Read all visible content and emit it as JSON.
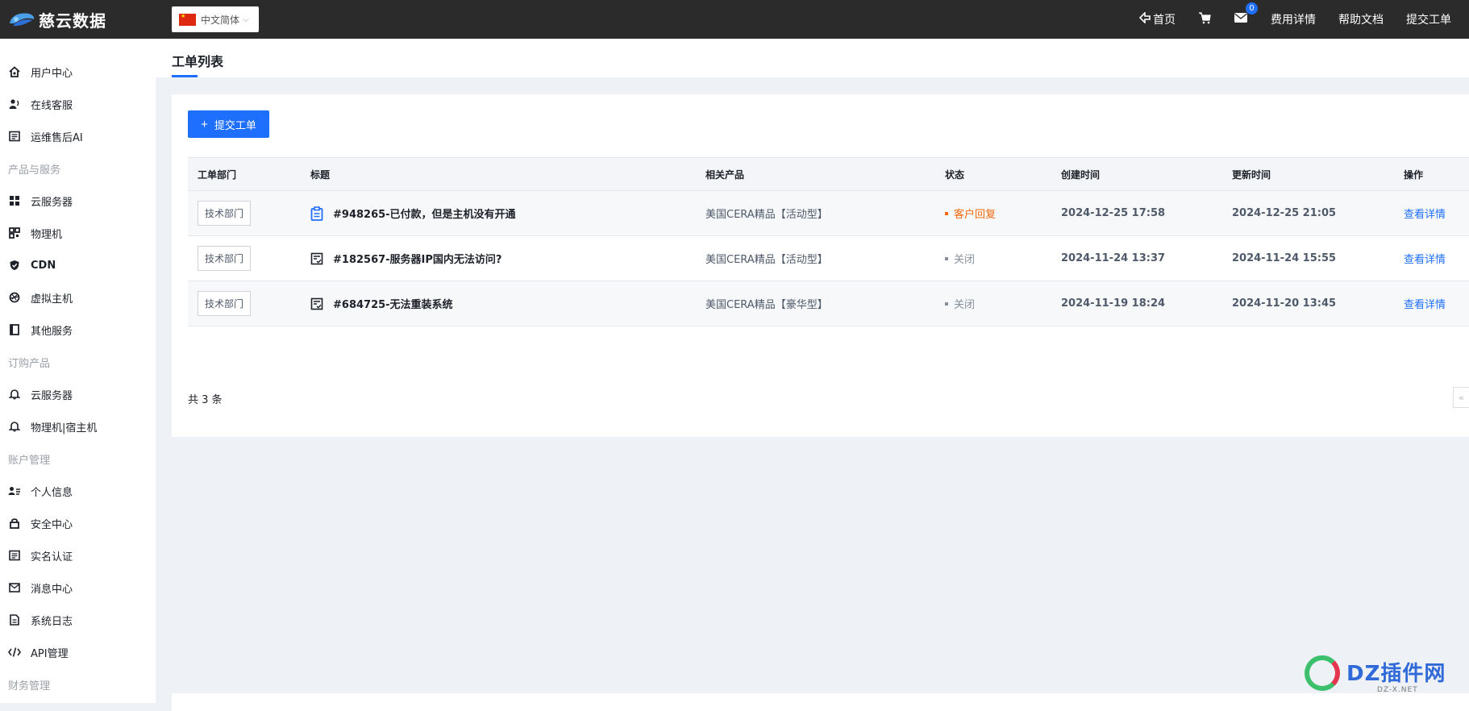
{
  "header": {
    "brand": "慈云数据",
    "language": "中文简体",
    "nav": {
      "home": "首页",
      "message_count": "0",
      "billing": "费用详情",
      "help": "帮助文档",
      "submit_ticket": "提交工单"
    }
  },
  "sidebar": {
    "top_items": [
      {
        "label": "用户中心",
        "icon": "home-icon"
      },
      {
        "label": "在线客服",
        "icon": "support-icon"
      },
      {
        "label": "运维售后AI",
        "icon": "document-icon"
      }
    ],
    "groups": [
      {
        "label": "产品与服务",
        "items": [
          {
            "label": "云服务器",
            "icon": "grid-icon"
          },
          {
            "label": "物理机",
            "icon": "qrcode-icon"
          },
          {
            "label": "CDN",
            "icon": "shield-icon"
          },
          {
            "label": "虚拟主机",
            "icon": "aperture-icon"
          },
          {
            "label": "其他服务",
            "icon": "book-icon"
          }
        ]
      },
      {
        "label": "订购产品",
        "items": [
          {
            "label": "云服务器",
            "icon": "bell-icon"
          },
          {
            "label": "物理机|宿主机",
            "icon": "bell-icon"
          }
        ]
      },
      {
        "label": "账户管理",
        "items": [
          {
            "label": "个人信息",
            "icon": "user-card-icon"
          },
          {
            "label": "安全中心",
            "icon": "lock-icon"
          },
          {
            "label": "实名认证",
            "icon": "id-card-icon"
          },
          {
            "label": "消息中心",
            "icon": "mail-icon"
          },
          {
            "label": "系统日志",
            "icon": "file-icon"
          },
          {
            "label": "API管理",
            "icon": "code-icon"
          }
        ]
      },
      {
        "label": "财务管理",
        "items": []
      }
    ]
  },
  "page": {
    "title": "工单列表",
    "submit_button": "提交工单",
    "total": "共 3 条",
    "pager_prev": "«"
  },
  "table": {
    "columns": [
      "工单部门",
      "标题",
      "相关产品",
      "状态",
      "创建时间",
      "更新时间",
      "操作"
    ],
    "rows": [
      {
        "dept": "技术部门",
        "title": "#948265-已付款，但是主机没有开通",
        "icon": "clipboard-icon",
        "product": "美国CERA精品【活动型】",
        "status": "客户回复",
        "status_type": "reply",
        "created": "2024-12-25 17:58",
        "updated": "2024-12-25 21:05",
        "action": "查看详情"
      },
      {
        "dept": "技术部门",
        "title": "#182567-服务器IP国内无法访问?",
        "icon": "checklist-icon",
        "product": "美国CERA精品【活动型】",
        "status": "关闭",
        "status_type": "closed",
        "created": "2024-11-24 13:37",
        "updated": "2024-11-24 15:55",
        "action": "查看详情"
      },
      {
        "dept": "技术部门",
        "title": "#684725-无法重装系统",
        "icon": "checklist-icon",
        "product": "美国CERA精品【豪华型】",
        "status": "关闭",
        "status_type": "closed",
        "created": "2024-11-19 18:24",
        "updated": "2024-11-20 13:45",
        "action": "查看详情"
      }
    ]
  },
  "watermark": {
    "title": "DZ插件网",
    "url": "DZ-X.NET"
  },
  "colors": {
    "accent": "#1f6fff",
    "topbar": "#2b2b2b",
    "status_reply": "#f5670a",
    "status_closed": "#86909c"
  }
}
